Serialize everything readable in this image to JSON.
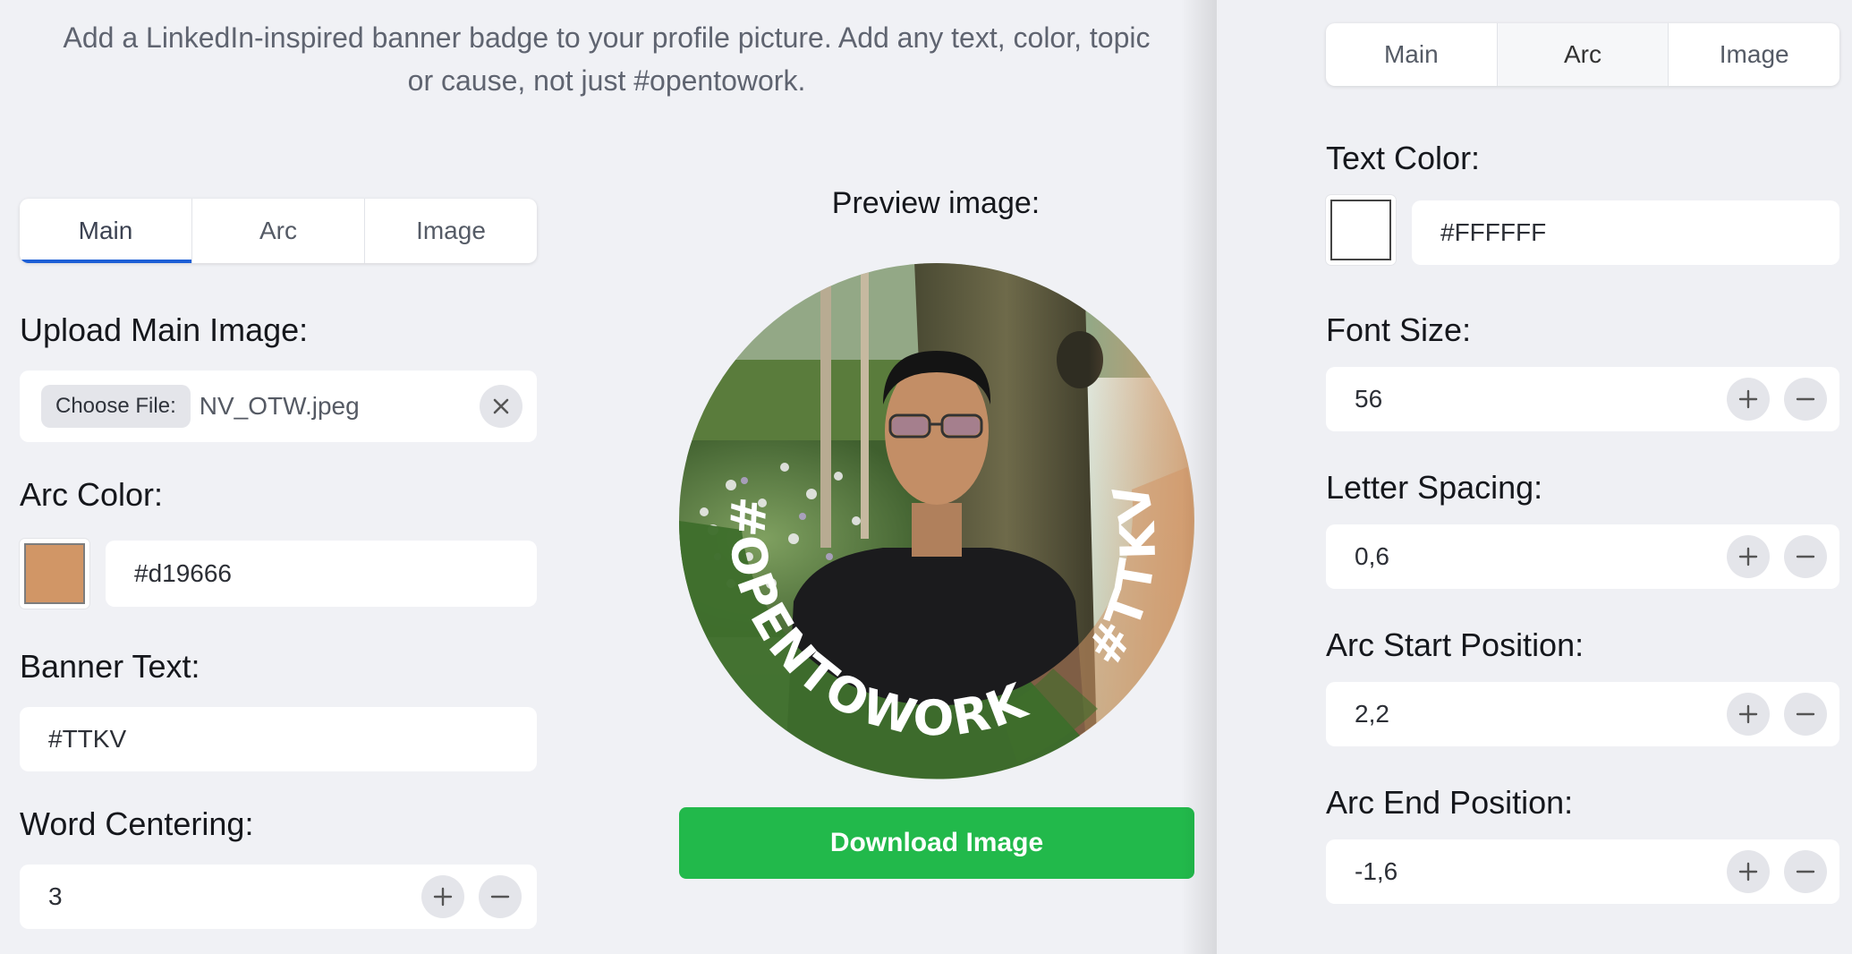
{
  "intro": {
    "line1": "Add a LinkedIn-inspired banner badge to your profile picture. Add any text, color, topic",
    "line2": "or cause, not just #opentowork."
  },
  "left_tabs": {
    "items": [
      "Main",
      "Arc",
      "Image"
    ],
    "active": "Main"
  },
  "main_form": {
    "upload_label": "Upload Main Image:",
    "choose_file_label": "Choose File:",
    "file_name": "NV_OTW.jpeg",
    "arc_color_label": "Arc Color:",
    "arc_color_value": "#d19666",
    "banner_text_label": "Banner Text:",
    "banner_text_value": "#TTKV",
    "word_centering_label": "Word Centering:",
    "word_centering_value": "3"
  },
  "preview": {
    "title": "Preview image:",
    "arc_text_left": "#OPENTOWORK",
    "arc_text_right": "#TTKV",
    "download_label": "Download Image"
  },
  "right_tabs": {
    "items": [
      "Main",
      "Arc",
      "Image"
    ],
    "active": "Arc"
  },
  "arc_form": {
    "text_color_label": "Text Color:",
    "text_color_value": "#FFFFFF",
    "font_size_label": "Font Size:",
    "font_size_value": "56",
    "letter_spacing_label": "Letter Spacing:",
    "letter_spacing_value": "0,6",
    "arc_start_label": "Arc Start Position:",
    "arc_start_value": "2,2",
    "arc_end_label": "Arc End Position:",
    "arc_end_value": "-1,6"
  },
  "colors": {
    "accent_blue": "#1d5fd6",
    "download_green": "#22b94b",
    "badge_green": "#3f6e2c",
    "arc_color": "#d19666",
    "text_color": "#FFFFFF"
  },
  "icons": {
    "clear": "close-icon",
    "plus": "plus-icon",
    "minus": "minus-icon"
  }
}
